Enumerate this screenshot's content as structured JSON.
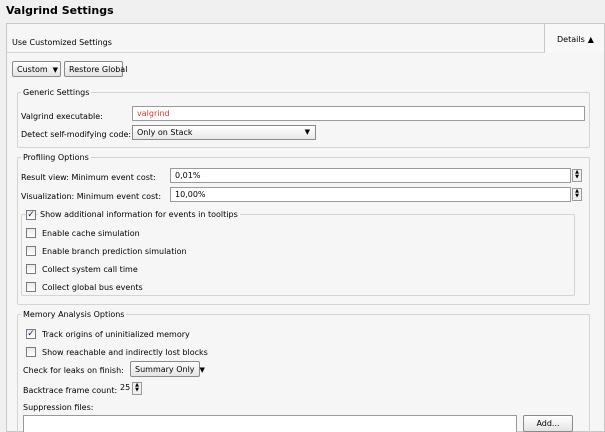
{
  "title": "Valgrind Settings",
  "header": {
    "label": "Use Customized Settings",
    "details_label": "Details",
    "details_arrow": "▲"
  },
  "toolbar": {
    "custom_label": "Custom",
    "restore_label": "Restore Global"
  },
  "generic": {
    "title": "Generic Settings",
    "executable_label": "Valgrind executable:",
    "executable_value": "valgrind",
    "detect_label": "Detect self-modifying code:",
    "detect_value": "Only on Stack"
  },
  "profiling": {
    "title": "Profiling Options",
    "result_label": "Result view: Minimum event cost:",
    "result_value": "0,01%",
    "vis_label": "Visualization: Minimum event cost:",
    "vis_value": "10,00%",
    "tooltips_label": "Show additional information for events in tooltips",
    "tooltips_checked": true,
    "options": [
      {
        "label": "Enable cache simulation",
        "checked": false
      },
      {
        "label": "Enable branch prediction simulation",
        "checked": false
      },
      {
        "label": "Collect system call time",
        "checked": false
      },
      {
        "label": "Collect global bus events",
        "checked": false
      }
    ]
  },
  "memory": {
    "title": "Memory Analysis Options",
    "track_label": "Track origins of uninitialized memory",
    "track_checked": true,
    "reachable_label": "Show reachable and indirectly lost blocks",
    "reachable_checked": false,
    "leaks_label": "Check for leaks on finish:",
    "leaks_value": "Summary Only",
    "backtrace_label": "Backtrace frame count:",
    "backtrace_value": "25",
    "suppression_label": "Suppression files:",
    "add_label": "Add..."
  },
  "icons": {
    "spin_up": "▲",
    "spin_down": "▼",
    "dropdown": "▼",
    "check": "✓"
  }
}
